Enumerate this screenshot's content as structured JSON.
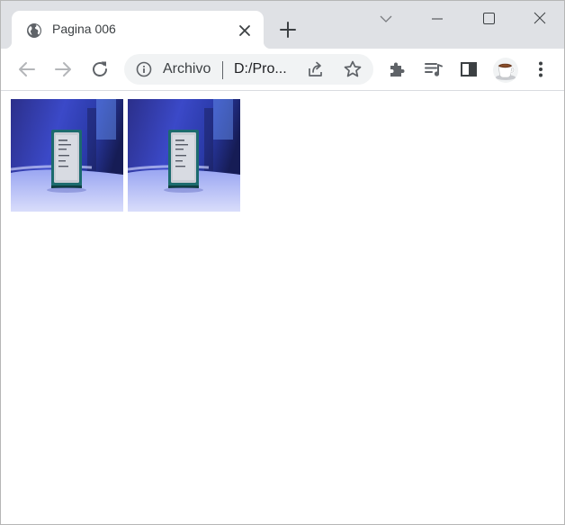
{
  "browser": {
    "tab": {
      "title": "Pagina 006",
      "favicon": "globe-icon",
      "close": "close-icon"
    },
    "new_tab": "plus-icon",
    "window_controls": [
      "chevron-down-icon",
      "minimize-icon",
      "maximize-icon",
      "close-icon"
    ],
    "toolbar": {
      "back": "back-arrow-icon",
      "forward": "forward-arrow-icon",
      "reload": "reload-icon",
      "site_info": "info-icon",
      "chip_label": "Archivo",
      "url": "D:/Pro...",
      "share": "share-icon",
      "bookmark": "star-icon",
      "extensions": "puzzle-icon",
      "media": "playlist-icon",
      "side_panel": "side-panel-icon",
      "profile": "coffee-cup-avatar",
      "menu": "kebab-menu-icon"
    }
  },
  "content": {
    "images": [
      {
        "depicts": "cpu-photo"
      },
      {
        "depicts": "cpu-photo"
      }
    ]
  },
  "colors": {
    "tabstrip": "#dfe1e5",
    "omnibox": "#f1f3f4",
    "icon": "#5f6368",
    "icon_disabled": "#b4b6b9"
  }
}
